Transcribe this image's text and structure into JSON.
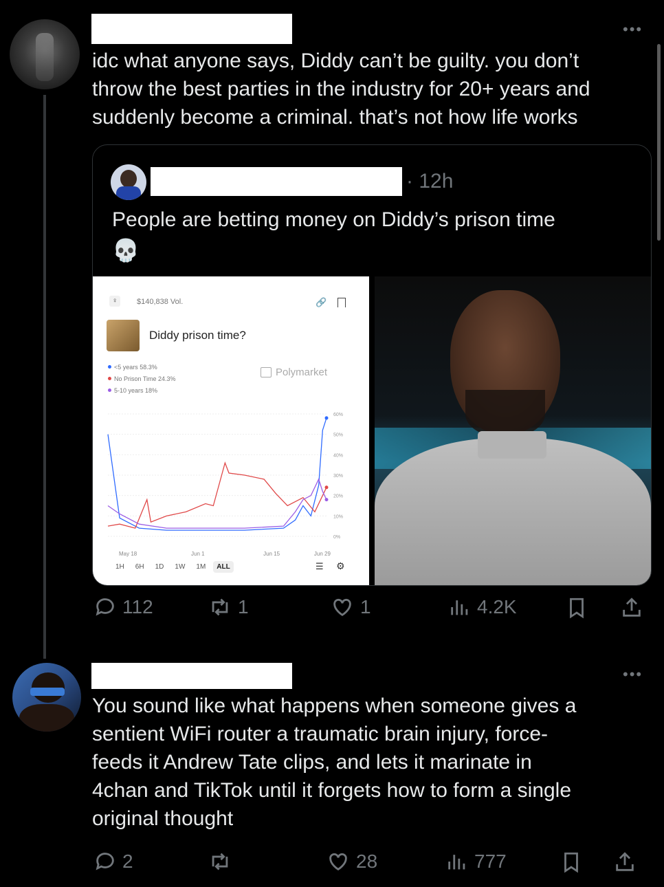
{
  "tweet1": {
    "more_label": "•••",
    "text": "idc what anyone says, Diddy can’t be guilty. you don’t\nthrow the best parties in the industry for 20+ years and\nsuddenly become a criminal. that’s not how life works",
    "quote": {
      "time": "· 12h",
      "text": "People are betting money on Diddy’s prison time",
      "emoji": "💀",
      "market_card": {
        "volume": "$140,838 Vol.",
        "title": "Diddy prison time?",
        "brand": "Polymarket",
        "legend": [
          {
            "label": "<5 years 58.3%",
            "color": "#2f6bff"
          },
          {
            "label": "No Prison Time 24.3%",
            "color": "#e04848"
          },
          {
            "label": "5-10 years 18%",
            "color": "#9b5de5"
          }
        ],
        "x_ticks": [
          "May 18",
          "Jun 1",
          "Jun 15",
          "Jun 29"
        ],
        "y_ticks": [
          "60%",
          "50%",
          "40%",
          "30%",
          "20%",
          "10%",
          "0%"
        ],
        "ranges": [
          "1H",
          "6H",
          "1D",
          "1W",
          "1M",
          "ALL"
        ],
        "active_range": "ALL"
      },
      "photo_alt": "Photo of a man in a grey collarless shirt"
    },
    "stats": {
      "replies": "112",
      "reposts": "1",
      "likes": "1",
      "views": "4.2K"
    }
  },
  "tweet2": {
    "more_label": "•••",
    "text": "You sound like what happens when someone gives a\nsentient WiFi router a traumatic brain injury, force-\nfeeds it Andrew Tate clips, and lets it marinate in\n4chan and TikTok until it forgets how to form a single\noriginal thought",
    "stats": {
      "replies": "2",
      "reposts": "",
      "likes": "28",
      "views": "777"
    }
  },
  "colors": {
    "background": "#000000",
    "text": "#e7e9ea",
    "muted": "#71767b",
    "border": "#2f3336"
  },
  "chart_data": {
    "type": "line",
    "x": [
      "May 18",
      "Jun 1",
      "Jun 15",
      "Jun 29"
    ],
    "series": [
      {
        "name": "<5 years",
        "color": "#2f6bff",
        "points": [
          [
            0,
            50
          ],
          [
            3,
            9
          ],
          [
            8,
            4
          ],
          [
            15,
            3
          ],
          [
            25,
            3
          ],
          [
            35,
            3
          ],
          [
            45,
            4
          ],
          [
            48,
            8
          ],
          [
            50,
            15
          ],
          [
            52,
            10
          ],
          [
            54,
            25
          ],
          [
            55,
            52
          ],
          [
            56,
            58
          ]
        ]
      },
      {
        "name": "No Prison Time",
        "color": "#e04848",
        "points": [
          [
            0,
            5
          ],
          [
            3,
            6
          ],
          [
            7,
            4
          ],
          [
            10,
            18
          ],
          [
            11,
            7
          ],
          [
            15,
            10
          ],
          [
            20,
            12
          ],
          [
            25,
            16
          ],
          [
            27,
            15
          ],
          [
            30,
            36
          ],
          [
            31,
            31
          ],
          [
            35,
            30
          ],
          [
            40,
            28
          ],
          [
            43,
            21
          ],
          [
            46,
            15
          ],
          [
            50,
            19
          ],
          [
            53,
            12
          ],
          [
            55,
            20
          ],
          [
            56,
            24
          ]
        ]
      },
      {
        "name": "5-10 years",
        "color": "#9b5de5",
        "points": [
          [
            0,
            15
          ],
          [
            3,
            11
          ],
          [
            8,
            6
          ],
          [
            15,
            4
          ],
          [
            25,
            4
          ],
          [
            35,
            4
          ],
          [
            45,
            5
          ],
          [
            48,
            12
          ],
          [
            50,
            18
          ],
          [
            52,
            20
          ],
          [
            54,
            28
          ],
          [
            55,
            22
          ],
          [
            56,
            18
          ]
        ]
      }
    ],
    "ylim": [
      0,
      60
    ],
    "grid": true,
    "legend": "top-left"
  }
}
